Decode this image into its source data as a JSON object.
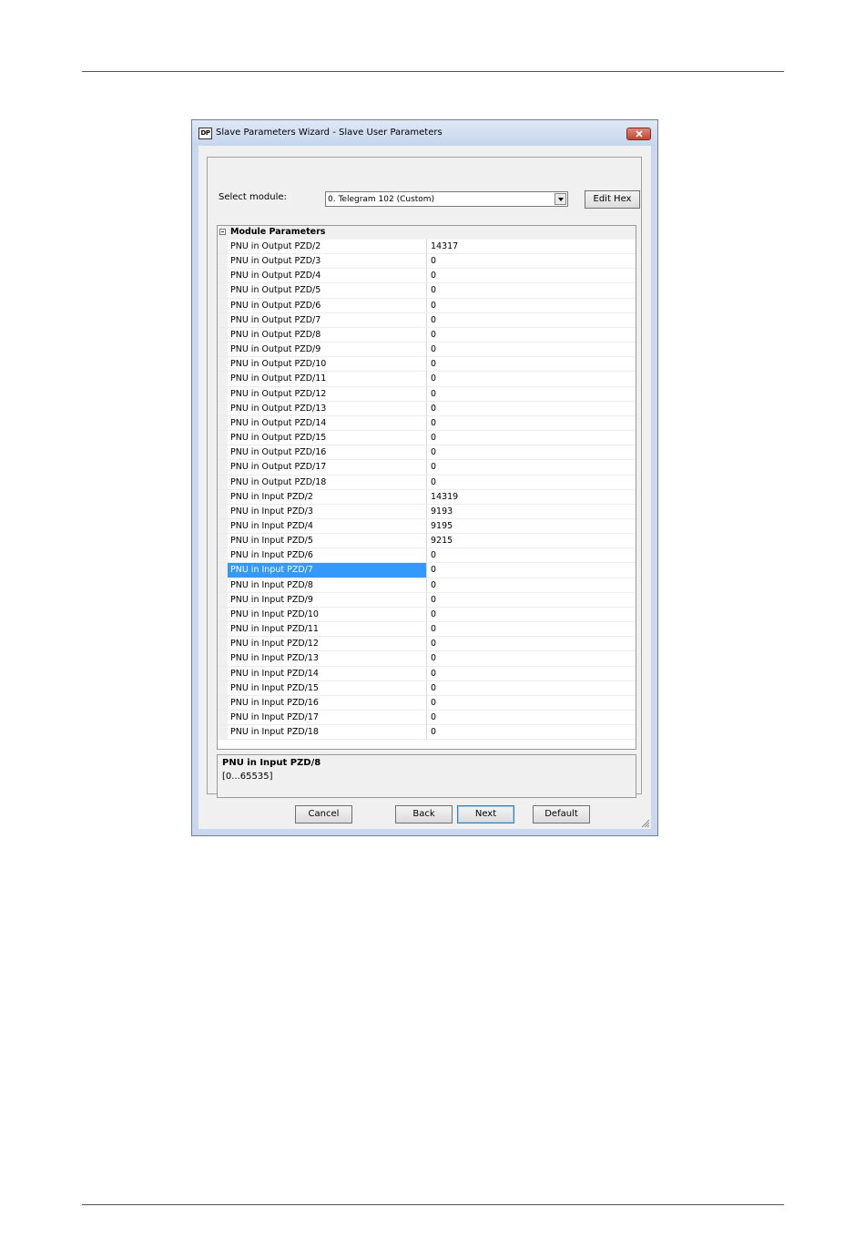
{
  "window": {
    "title": "Slave Parameters Wizard - Slave User Parameters",
    "icon_text": "DP"
  },
  "module_select": {
    "label": "Select module:",
    "value": "0. Telegram 102 (Custom)"
  },
  "buttons": {
    "edit_hex": "Edit Hex",
    "cancel": "Cancel",
    "back": "Back",
    "next": "Next",
    "default": "Default"
  },
  "grid": {
    "category": "Module Parameters",
    "selected_index": 22,
    "rows": [
      {
        "name": "PNU in Output PZD/2",
        "value": "14317"
      },
      {
        "name": "PNU in Output PZD/3",
        "value": "0"
      },
      {
        "name": "PNU in Output PZD/4",
        "value": "0"
      },
      {
        "name": "PNU in Output PZD/5",
        "value": "0"
      },
      {
        "name": "PNU in Output PZD/6",
        "value": "0"
      },
      {
        "name": "PNU in Output PZD/7",
        "value": "0"
      },
      {
        "name": "PNU in Output PZD/8",
        "value": "0"
      },
      {
        "name": "PNU in Output PZD/9",
        "value": "0"
      },
      {
        "name": "PNU in Output PZD/10",
        "value": "0"
      },
      {
        "name": "PNU in Output PZD/11",
        "value": "0"
      },
      {
        "name": "PNU in Output PZD/12",
        "value": "0"
      },
      {
        "name": "PNU in Output PZD/13",
        "value": "0"
      },
      {
        "name": "PNU in Output PZD/14",
        "value": "0"
      },
      {
        "name": "PNU in Output PZD/15",
        "value": "0"
      },
      {
        "name": "PNU in Output PZD/16",
        "value": "0"
      },
      {
        "name": "PNU in Output PZD/17",
        "value": "0"
      },
      {
        "name": "PNU in Output PZD/18",
        "value": "0"
      },
      {
        "name": "PNU in Input PZD/2",
        "value": "14319"
      },
      {
        "name": "PNU in Input PZD/3",
        "value": "9193"
      },
      {
        "name": "PNU in Input PZD/4",
        "value": "9195"
      },
      {
        "name": "PNU in Input PZD/5",
        "value": "9215"
      },
      {
        "name": "PNU in Input PZD/6",
        "value": "0"
      },
      {
        "name": "PNU in Input PZD/7",
        "value": "0"
      },
      {
        "name": "PNU in Input PZD/8",
        "value": "0"
      },
      {
        "name": "PNU in Input PZD/9",
        "value": "0"
      },
      {
        "name": "PNU in Input PZD/10",
        "value": "0"
      },
      {
        "name": "PNU in Input PZD/11",
        "value": "0"
      },
      {
        "name": "PNU in Input PZD/12",
        "value": "0"
      },
      {
        "name": "PNU in Input PZD/13",
        "value": "0"
      },
      {
        "name": "PNU in Input PZD/14",
        "value": "0"
      },
      {
        "name": "PNU in Input PZD/15",
        "value": "0"
      },
      {
        "name": "PNU in Input PZD/16",
        "value": "0"
      },
      {
        "name": "PNU in Input PZD/17",
        "value": "0"
      },
      {
        "name": "PNU in Input PZD/18",
        "value": "0"
      }
    ]
  },
  "description": {
    "title": "PNU in Input PZD/8",
    "range": "[0...65535]"
  }
}
